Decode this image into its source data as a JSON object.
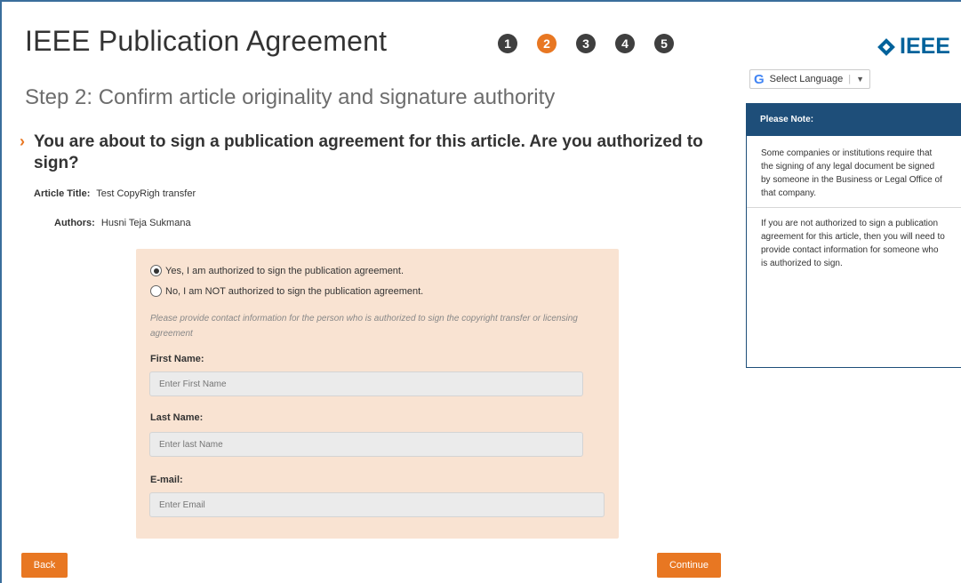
{
  "header": {
    "title": "IEEE Publication Agreement",
    "steps": [
      "1",
      "2",
      "3",
      "4",
      "5"
    ],
    "active_step": 2,
    "logo_text": "IEEE"
  },
  "language": {
    "label": "Select Language",
    "icon": "google-g-icon"
  },
  "page": {
    "step_heading": "Step 2: Confirm article originality and signature authority",
    "question": "You are about to sign a publication agreement for this article. Are you authorized to sign?"
  },
  "article": {
    "title_label": "Article Title:",
    "title_value": "Test CopyRigh transfer",
    "authors_label": "Authors:",
    "authors_value": "Husni Teja Sukmana"
  },
  "form": {
    "option_yes": "Yes, I am authorized to sign the publication agreement.",
    "option_no": "No, I am NOT authorized to sign the publication agreement.",
    "selected_option": "yes",
    "hint": "Please provide contact information for the person who is authorized to sign the copyright transfer or licensing agreement",
    "first_name_label": "First Name:",
    "first_name_placeholder": "Enter First Name",
    "last_name_label": "Last Name:",
    "last_name_placeholder": "Enter last Name",
    "email_label": "E-mail:",
    "email_placeholder": "Enter Email"
  },
  "note": {
    "title": "Please Note:",
    "paragraph1": "Some companies or institutions require that the signing of any legal document be signed by someone in the Business or Legal Office of that company.",
    "paragraph2": "If you are not authorized to sign a publication agreement for this article, then you will need to provide contact information for someone who is authorized to sign."
  },
  "buttons": {
    "back": "Back",
    "continue": "Continue"
  },
  "colors": {
    "accent": "#e87722",
    "step_inactive": "#3f3f3f",
    "note_header": "#1e4e79",
    "form_panel": "#f9e3d2",
    "ieee_blue": "#00629b"
  }
}
